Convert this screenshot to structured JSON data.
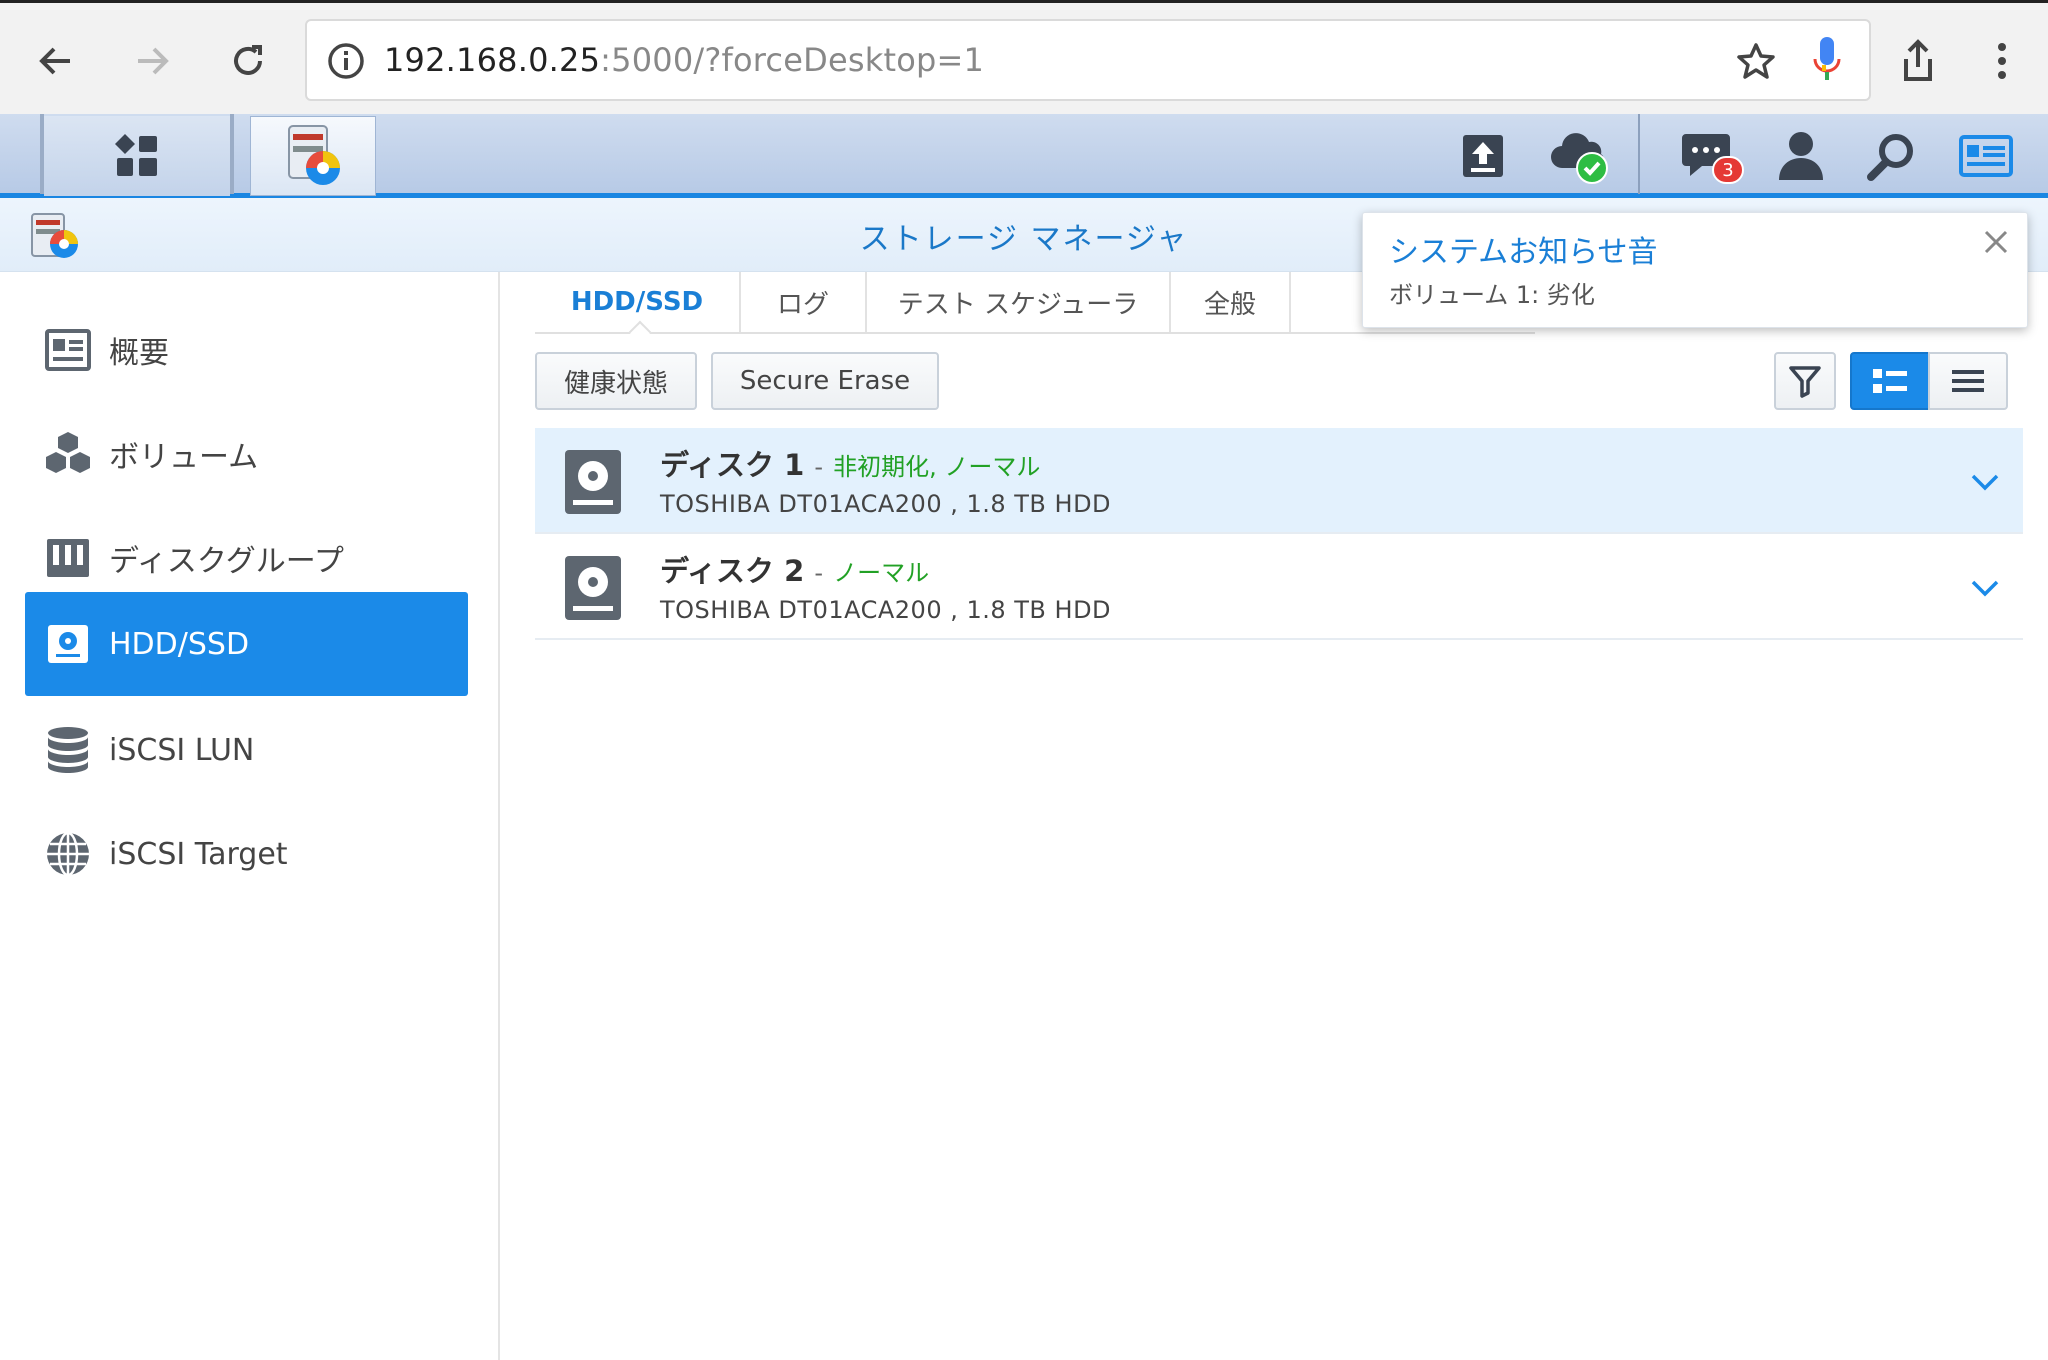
{
  "browser": {
    "url_host": "192.168.0.25",
    "url_rest": ":5000/?forceDesktop=1"
  },
  "taskbar": {
    "chat_badge": "3"
  },
  "app": {
    "title": "ストレージ マネージャ"
  },
  "sidebar": {
    "items": [
      {
        "label": "概要",
        "icon": "overview-icon"
      },
      {
        "label": "ボリューム",
        "icon": "volume-icon"
      },
      {
        "label": "ディスクグループ",
        "icon": "disk-group-icon"
      },
      {
        "label": "HDD/SSD",
        "icon": "hdd-icon",
        "active": true
      },
      {
        "label": "iSCSI LUN",
        "icon": "database-icon"
      },
      {
        "label": "iSCSI Target",
        "icon": "globe-icon"
      }
    ]
  },
  "tabs": [
    {
      "label": "HDD/SSD",
      "active": true
    },
    {
      "label": "ログ"
    },
    {
      "label": "テスト スケジューラ"
    },
    {
      "label": "全般"
    }
  ],
  "toolbar": {
    "health_label": "健康状態",
    "secure_erase_label": "Secure Erase"
  },
  "disks": [
    {
      "name": "ディスク 1",
      "separator": "-",
      "status": "非初期化, ノーマル",
      "details": "TOSHIBA DT01ACA200 , 1.8 TB HDD"
    },
    {
      "name": "ディスク 2",
      "separator": "-",
      "status": "ノーマル",
      "details": "TOSHIBA DT01ACA200 , 1.8 TB HDD"
    }
  ],
  "notification": {
    "title": "システムお知らせ音",
    "body": "ボリューム 1: 劣化"
  },
  "colors": {
    "accent": "#1b8ae8",
    "status_ok": "#22a125"
  }
}
